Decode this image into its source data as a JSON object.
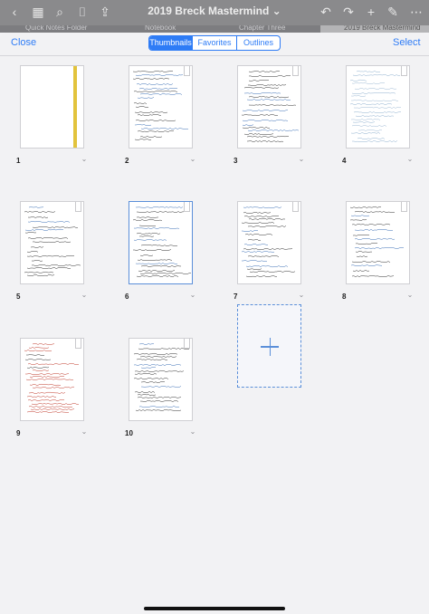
{
  "app": {
    "title": "2019 Breck Mastermind",
    "tabs": [
      "Quick Notes Folder",
      "Notebook",
      "Chapter Three",
      "2019 Breck Mastermind"
    ]
  },
  "sheet": {
    "close_label": "Close",
    "select_label": "Select",
    "segments": [
      "Thumbnails",
      "Favorites",
      "Outlines"
    ],
    "active_segment": "Thumbnails"
  },
  "pages": [
    {
      "number": "1",
      "kind": "cover"
    },
    {
      "number": "2",
      "kind": "notes"
    },
    {
      "number": "3",
      "kind": "notes"
    },
    {
      "number": "4",
      "kind": "notes-light"
    },
    {
      "number": "5",
      "kind": "notes"
    },
    {
      "number": "6",
      "kind": "notes",
      "selected": true
    },
    {
      "number": "7",
      "kind": "notes"
    },
    {
      "number": "8",
      "kind": "notes"
    },
    {
      "number": "9",
      "kind": "notes-red"
    },
    {
      "number": "10",
      "kind": "notes"
    }
  ],
  "colors": {
    "accent": "#2e7cf6",
    "cover_strip": "#e2c33c",
    "selection": "#5b8fd9"
  }
}
